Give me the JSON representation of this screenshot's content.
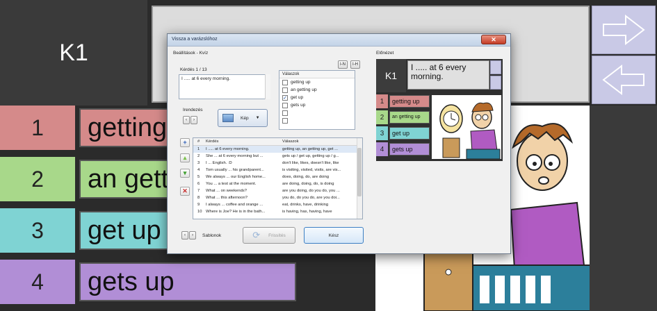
{
  "board": {
    "k1": "K1",
    "question": "I ..... at 6 every morning.",
    "answers": [
      {
        "num": "1",
        "text": "getting up",
        "color": "#d58a8a"
      },
      {
        "num": "2",
        "text": "an getting up",
        "color": "#a8d88a"
      },
      {
        "num": "3",
        "text": "get up",
        "color": "#7fd3d3"
      },
      {
        "num": "4",
        "text": "gets up",
        "color": "#b18ed6"
      }
    ],
    "nav_color": "#c9c9e6"
  },
  "dialog": {
    "title": "Vissza a varázslóhoz",
    "close_label": "✕",
    "settings_group": "Beállítások - Kvíz",
    "in_button": "I-N",
    "ih_button": "I-H",
    "question_counter": "Kérdés 1 / 13",
    "question_text": "I ..... at 6 every morning.",
    "answers_header": "Válaszok",
    "answer_options": [
      {
        "text": "getting up",
        "checked": false
      },
      {
        "text": "an getting up",
        "checked": false
      },
      {
        "text": "get up",
        "checked": true
      },
      {
        "text": "gets up",
        "checked": false
      },
      {
        "text": "",
        "checked": false
      },
      {
        "text": "",
        "checked": false
      }
    ],
    "arrange_label": "Irendezés",
    "picture_button": "Kép",
    "table": {
      "col_num": "#",
      "col_question": "Kérdés",
      "col_answers": "Válaszok",
      "rows": [
        {
          "num": "1",
          "question": "I ..... at 6 every morning.",
          "answers": "getting up, an getting up, get ..."
        },
        {
          "num": "2",
          "question": "She ... at 6 every morning but ...",
          "answers": "gets up / get up, getting up / g..."
        },
        {
          "num": "3",
          "question": "I ... English. :D",
          "answers": "don't like, likes, doesn't like, like"
        },
        {
          "num": "4",
          "question": "Tom usually ... his grandparent...",
          "answers": "is visiting, visited, visits, are vis..."
        },
        {
          "num": "5",
          "question": "We always ... our English home...",
          "answers": "does, doing, do, are doing"
        },
        {
          "num": "6",
          "question": "You ... a test at the moment.",
          "answers": "are doing, doing, do, is doing"
        },
        {
          "num": "7",
          "question": "What ... on weekends?",
          "answers": "are you doing, do you do, you ..."
        },
        {
          "num": "8",
          "question": "What ... this afternoon?",
          "answers": "you do, do you do, are you doi..."
        },
        {
          "num": "9",
          "question": "I always ... coffee and orange ...",
          "answers": "eat, drinks, have, drinking"
        },
        {
          "num": "10",
          "question": "Where is Joe? He is in the bath...",
          "answers": "is having, has, having, have"
        }
      ]
    },
    "templates_label": "Sablonok",
    "refresh_button": "Frissítés",
    "done_button": "Kész",
    "preview_label": "Előnézet",
    "preview": {
      "k1": "K1",
      "question": "I ..... at 6 every morning."
    }
  }
}
